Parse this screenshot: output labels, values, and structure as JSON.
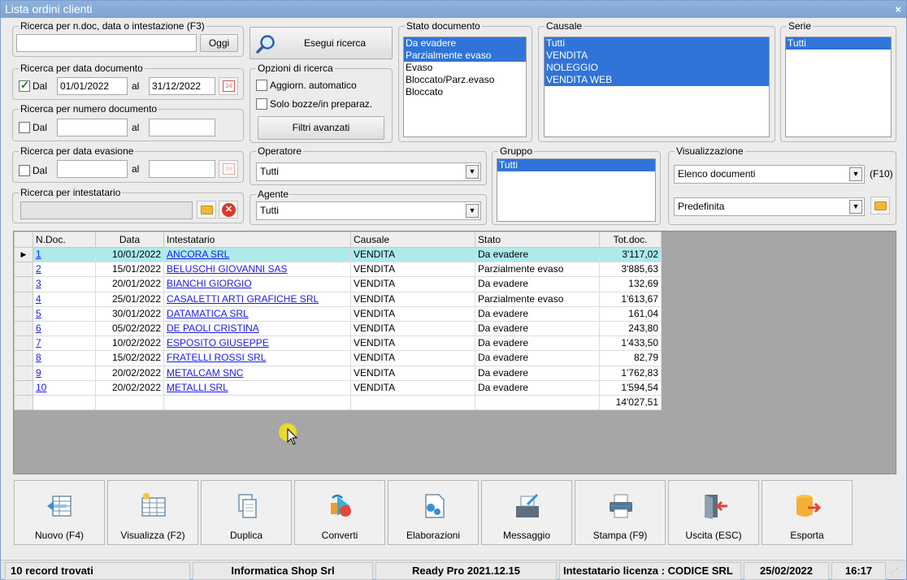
{
  "window": {
    "title": "Lista ordini clienti",
    "close_symbol": "×"
  },
  "search_doc": {
    "legend": "Ricerca per n.doc, data o intestazione (F3)",
    "value": "",
    "today_button": "Oggi"
  },
  "execute": {
    "label": "Esegui ricerca"
  },
  "date_doc": {
    "legend": "Ricerca per data documento",
    "dal_label": "Dal",
    "checked": true,
    "from": "01/01/2022",
    "al_label": "al",
    "to": "31/12/2022"
  },
  "options": {
    "legend": "Opzioni di ricerca",
    "auto_update": "Aggiorn. automatico",
    "drafts_only": "Solo bozze/in preparaz.",
    "advanced_filters": "Filtri avanzati"
  },
  "num_doc": {
    "legend": "Ricerca per numero documento",
    "dal_label": "Dal",
    "al_label": "al",
    "from": "",
    "to": ""
  },
  "date_eva": {
    "legend": "Ricerca per data evasione",
    "dal_label": "Dal",
    "al_label": "al",
    "from": "",
    "to": ""
  },
  "holder": {
    "legend": "Ricerca per intestatario",
    "value": ""
  },
  "stato": {
    "legend": "Stato documento",
    "items": [
      {
        "label": "Da evadere",
        "selected": true
      },
      {
        "label": "Parzialmente evaso",
        "selected": true
      },
      {
        "label": "Evaso",
        "selected": false
      },
      {
        "label": "Bloccato/Parz.evaso",
        "selected": false
      },
      {
        "label": "Bloccato",
        "selected": false
      }
    ]
  },
  "causale": {
    "legend": "Causale",
    "items": [
      {
        "label": "Tutti",
        "selected": true
      },
      {
        "label": "VENDITA",
        "selected": true
      },
      {
        "label": "NOLEGGIO",
        "selected": true
      },
      {
        "label": "VENDITA WEB",
        "selected": true
      }
    ]
  },
  "serie": {
    "legend": "Serie",
    "items": [
      {
        "label": "Tutti",
        "selected": true
      }
    ]
  },
  "operatore": {
    "legend": "Operatore",
    "value": "Tutti"
  },
  "agente": {
    "legend": "Agente",
    "value": "Tutti"
  },
  "gruppo": {
    "legend": "Gruppo",
    "items": [
      {
        "label": "Tutti",
        "selected": true
      }
    ]
  },
  "visualizzazione": {
    "legend": "Visualizzazione",
    "value": "Elenco documenti",
    "shortcut": "(F10)",
    "layout": "Predefinita"
  },
  "grid": {
    "columns": [
      "N.Doc.",
      "Data",
      "Intestatario",
      "Causale",
      "Stato",
      "Tot.doc."
    ],
    "current_marker": "▶",
    "rows": [
      {
        "n": "1",
        "data": "10/01/2022",
        "intestatario": "ANCORA SRL",
        "causale": "VENDITA",
        "stato": "Da evadere",
        "tot": "3'117,02"
      },
      {
        "n": "2",
        "data": "15/01/2022",
        "intestatario": "BELUSCHI GIOVANNI SAS",
        "causale": "VENDITA",
        "stato": "Parzialmente evaso",
        "tot": "3'885,63"
      },
      {
        "n": "3",
        "data": "20/01/2022",
        "intestatario": "BIANCHI GIORGIO",
        "causale": "VENDITA",
        "stato": "Da evadere",
        "tot": "132,69"
      },
      {
        "n": "4",
        "data": "25/01/2022",
        "intestatario": "CASALETTI ARTI GRAFICHE SRL",
        "causale": "VENDITA",
        "stato": "Parzialmente evaso",
        "tot": "1'613,67"
      },
      {
        "n": "5",
        "data": "30/01/2022",
        "intestatario": "DATAMATICA SRL",
        "causale": "VENDITA",
        "stato": "Da evadere",
        "tot": "161,04"
      },
      {
        "n": "6",
        "data": "05/02/2022",
        "intestatario": "DE PAOLI CRISTINA",
        "causale": "VENDITA",
        "stato": "Da evadere",
        "tot": "243,80"
      },
      {
        "n": "7",
        "data": "10/02/2022",
        "intestatario": "ESPOSITO GIUSEPPE",
        "causale": "VENDITA",
        "stato": "Da evadere",
        "tot": "1'433,50"
      },
      {
        "n": "8",
        "data": "15/02/2022",
        "intestatario": "FRATELLI ROSSI SRL",
        "causale": "VENDITA",
        "stato": "Da evadere",
        "tot": "82,79"
      },
      {
        "n": "9",
        "data": "20/02/2022",
        "intestatario": "METALCAM SNC",
        "causale": "VENDITA",
        "stato": "Da evadere",
        "tot": "1'762,83"
      },
      {
        "n": "10",
        "data": "20/02/2022",
        "intestatario": "METALLI SRL",
        "causale": "VENDITA",
        "stato": "Da evadere",
        "tot": "1'594,54"
      }
    ],
    "total": "14'027,51"
  },
  "toolbar": [
    {
      "label": "Nuovo (F4)",
      "icon": "new-icon"
    },
    {
      "label": "Visualizza (F2)",
      "icon": "view-icon"
    },
    {
      "label": "Duplica",
      "icon": "duplicate-icon"
    },
    {
      "label": "Converti",
      "icon": "convert-icon"
    },
    {
      "label": "Elaborazioni",
      "icon": "process-icon"
    },
    {
      "label": "Messaggio",
      "icon": "message-icon"
    },
    {
      "label": "Stampa (F9)",
      "icon": "print-icon"
    },
    {
      "label": "Uscita (ESC)",
      "icon": "exit-icon"
    },
    {
      "label": "Esporta",
      "icon": "export-icon"
    }
  ],
  "status": {
    "records": "10 record trovati",
    "company": "Informatica Shop Srl",
    "version": "Ready Pro 2021.12.15",
    "license": "Intestatario licenza : CODICE SRL",
    "date": "25/02/2022",
    "time": "16:17"
  },
  "colors": {
    "selection": "#3074d9",
    "current_row": "#aeeaea",
    "link": "#1a1aee",
    "titlebar": "#7da3d2"
  }
}
